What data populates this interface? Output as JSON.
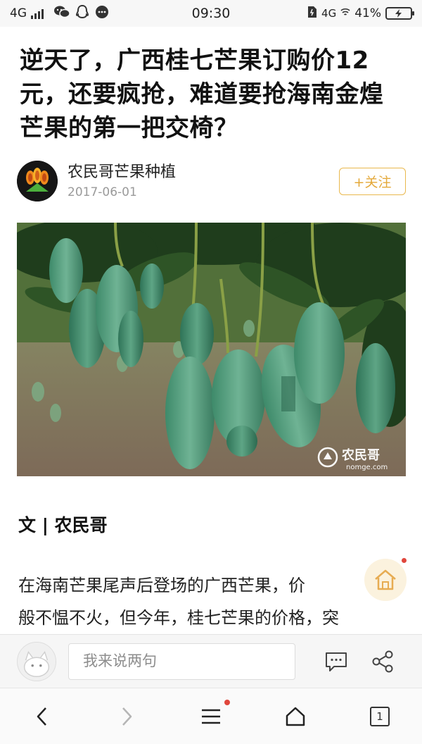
{
  "status_bar": {
    "network_left": "4G",
    "time": "09:30",
    "network_right": "4G",
    "battery_percent": "41%",
    "icons": [
      "signal-icon",
      "wechat-icon",
      "qq-icon",
      "message-icon",
      "sim-icon",
      "wifi-icon",
      "battery-icon"
    ]
  },
  "article": {
    "title": "逆天了，广西桂七芒果订购价12元，还要疯抢，难道要抢海南金煌芒果的第一把交椅？",
    "author": {
      "name": "农民哥芒果种植",
      "date": "2017-06-01",
      "follow_label": "+关注"
    },
    "image": {
      "watermark_brand": "农民哥",
      "watermark_url": "nomge.com"
    },
    "byline": "文 | 农民哥",
    "body_lines": [
      "在海南芒果尾声后登场的广西芒果，价",
      "般不愠不火，但今年，桂七芒果的价格，突"
    ]
  },
  "comment_bar": {
    "input_placeholder": "我来说两句",
    "icons": [
      "comment-icon",
      "share-icon"
    ]
  },
  "nav_bar": {
    "tab_count": "1",
    "icons": [
      "back-icon",
      "forward-icon",
      "menu-icon",
      "home-icon",
      "tabs-icon"
    ]
  },
  "colors": {
    "accent_follow": "#e4a93a",
    "notification_dot": "#e0463c",
    "text_primary": "#111111",
    "text_muted": "#9a9a9a"
  }
}
